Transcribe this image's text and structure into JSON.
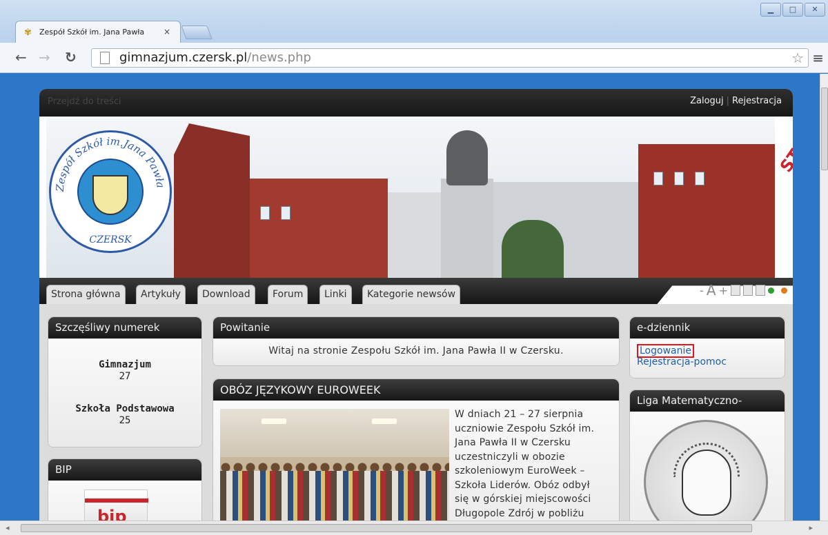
{
  "browser": {
    "tab_title": "Zespół Szkół im. Jana Pawła",
    "tab_close": "×",
    "url_domain": "gimnazjum.czersk.pl",
    "url_path": "/news.php",
    "window_controls": [
      "▁",
      "□",
      "✕"
    ]
  },
  "site": {
    "skip_link": "Przejdź do treści",
    "login_link": "Zaloguj",
    "register_link": "Rejestracja",
    "banner_logo_text": "Zespół Szkół im.Jana Pawła II",
    "banner_logo_city": "CZERSK",
    "banner_ad_text": "STOWARZY",
    "nav": [
      "Strona główna",
      "Artykuły",
      "Download",
      "Forum",
      "Linki",
      "Kategorie newsów"
    ],
    "font_controls": {
      "minus": "-",
      "letter": "A",
      "plus": "+"
    },
    "theme_colors": [
      "#2e9e2e",
      "#e07b1a"
    ]
  },
  "left": {
    "numerek_title": "Szczęśliwy numerek",
    "gimnazjum_label": "Gimnazjum",
    "gimnazjum_value": "27",
    "podstawowa_label": "Szkoła Podstawowa",
    "podstawowa_value": "25",
    "bip_title": "BIP",
    "bip_logo": "bip"
  },
  "center": {
    "powitanie_title": "Powitanie",
    "powitanie_text": "Witaj na stronie Zespołu Szkół im. Jana Pawła II w Czersku.",
    "oboz_title": "OBÓZ JĘZYKOWY EUROWEEK",
    "oboz_lines": [
      "W dniach 21 – 27 sierpnia",
      "uczniowie Zespołu Szkół im.",
      "Jana Pawła II w Czersku",
      "uczestniczyli w obozie",
      "szkoleniowym EuroWeek –",
      "Szkoła Liderów. Obóz odbył",
      "się w górskiej miejscowości",
      "Długopole Zdrój w pobliżu"
    ]
  },
  "right": {
    "edziennik_title": "e-dziennik",
    "logowanie": "Logowanie",
    "rejestracja_pomoc": "Rejestracja-pomoc",
    "liga_title": "Liga Matematyczno-"
  },
  "colors": {
    "page_bg": "#2c77c8",
    "highlight": "#e5141b",
    "link": "#1f5fa8"
  }
}
